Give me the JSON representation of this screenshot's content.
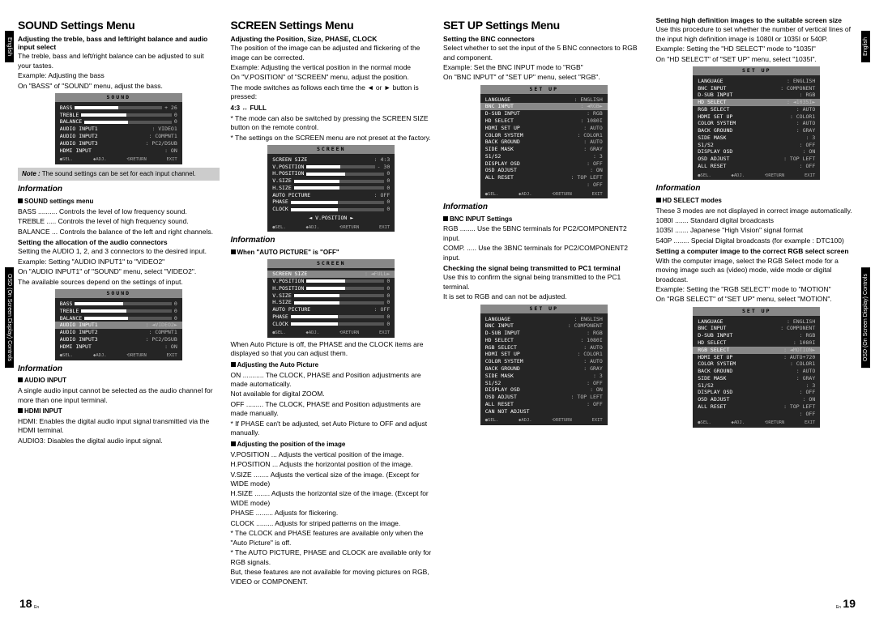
{
  "tabs": {
    "english": "English",
    "osd": "OSD (On Screen Display) Controls"
  },
  "col1": {
    "h2": "SOUND Settings Menu",
    "h3a": "Adjusting the treble, bass and left/right balance and audio input select",
    "p1": "The treble, bass and left/right balance can be adjusted to suit your tastes.",
    "ex1": "Example: Adjusting the bass",
    "p2": "On \"BASS\" of \"SOUND\" menu, adjust the bass.",
    "note": "The sound settings can be set for each input channel.",
    "info": "Information",
    "h4a": "SOUND settings menu",
    "def1": "BASS .......... Controls the level of low frequency sound.",
    "def2": "TREBLE ..... Controls the level of high frequency sound.",
    "def3": "BALANCE ... Controls the balance of the left and right channels.",
    "h3b": "Setting the allocation of the audio connectors",
    "p3": "Setting the AUDIO 1, 2, and 3 connectors to the desired input.",
    "ex2": "Example: Setting \"AUDIO INPUT1\" to \"VIDEO2\"",
    "p4": "On \"AUDIO INPUT1\" of \"SOUND\" menu, select \"VIDEO2\".",
    "p5": "The available sources depend on the settings of input.",
    "h4b": "AUDIO INPUT",
    "p6": "A single audio input cannot be selected as the audio channel for more than one input terminal.",
    "h4c": "HDMI INPUT",
    "def4": "HDMI: Enables the digital audio input signal transmitted via the HDMI terminal.",
    "def5": "AUDIO3: Disables the digital audio input signal."
  },
  "osd1": {
    "title": "SOUND",
    "rows": [
      [
        "BASS",
        "■",
        "+ 26"
      ],
      [
        "TREBLE",
        "■",
        "0"
      ],
      [
        "BALANCE",
        "■",
        "0"
      ],
      [
        "AUDIO INPUT1",
        ": VIDEO1"
      ],
      [
        "AUDIO INPUT2",
        ": COMPNT1"
      ],
      [
        "AUDIO INPUT3",
        ": PC2/DSUB"
      ],
      [
        "HDMI INPUT",
        ": ON"
      ]
    ]
  },
  "osd2": {
    "title": "SOUND",
    "rows": [
      [
        "BASS",
        "■",
        "0"
      ],
      [
        "TREBLE",
        "■",
        "0"
      ],
      [
        "BALANCE",
        "■",
        "0"
      ],
      [
        "AUDIO INPUT1",
        ": ◄VIDEO2►"
      ],
      [
        "AUDIO INPUT2",
        ": COMPNT1"
      ],
      [
        "AUDIO INPUT3",
        ": PC2/DSUB"
      ],
      [
        "HDMI INPUT",
        ": ON"
      ]
    ]
  },
  "col2": {
    "h2": "SCREEN Settings Menu",
    "h3a": "Adjusting the Position, Size, PHASE, CLOCK",
    "p1": "The position of the image can be adjusted and flickering of the image can be corrected.",
    "ex1": "Example: Adjusting the vertical position in the normal mode",
    "p2": "On \"V.POSITION\" of \"SCREEN\" menu, adjust the position.",
    "p3": "The mode switches as follows each time the ◄ or ► button is pressed:",
    "mode": "4:3 ↔ FULL",
    "b1": "* The mode can also be switched by pressing the SCREEN SIZE button on the remote control.",
    "b2": "* The settings on the SCREEN menu are not preset at the factory.",
    "info": "Information",
    "h4a": "When \"AUTO PICTURE\" is \"OFF\"",
    "p4": "When Auto Picture is off, the PHASE and the CLOCK items are displayed so that you can adjust them.",
    "h4b": "Adjusting the Auto Picture",
    "def1": "ON ........... The CLOCK, PHASE and Position adjustments are made automatically.",
    "def1b": "Not available for digital ZOOM.",
    "def2": "OFF ......... The CLOCK, PHASE and Position adjustments are made manually.",
    "b3": "* If PHASE can't be adjusted, set Auto Picture to OFF and adjust manually.",
    "h4c": "Adjusting the position of the image",
    "d1": "V.POSITION ... Adjusts the vertical position of the image.",
    "d2": "H.POSITION ... Adjusts the horizontal position of the image.",
    "d3": "V.SIZE ........ Adjusts the vertical size of the image. (Except for WIDE mode)",
    "d4": "H.SIZE ........ Adjusts the horizontal size of the image. (Except for WIDE mode)",
    "d5": "PHASE ......... Adjusts for flickering.",
    "d6": "CLOCK ......... Adjusts for striped patterns on the image.",
    "b4": "* The CLOCK and PHASE features are available only when the \"Auto Picture\" is off.",
    "b5": "* The AUTO PICTURE, PHASE and CLOCK are available only for RGB signals.",
    "b6": "But, these features are not available for moving pictures on RGB, VIDEO or COMPONENT."
  },
  "osd3": {
    "title": "SCREEN",
    "rows": [
      [
        "SCREEN SIZE",
        ": 4:3"
      ],
      [
        "V.POSITION",
        "■",
        "- 30"
      ],
      [
        "H.POSITION",
        "■",
        "0"
      ],
      [
        "V.SIZE",
        "■",
        "0"
      ],
      [
        "H.SIZE",
        "■",
        "0"
      ],
      [
        "AUTO PICTURE",
        ": OFF"
      ],
      [
        "PHASE",
        "■",
        "0"
      ],
      [
        "CLOCK",
        "■",
        "0"
      ]
    ],
    "mid": "◄  V.POSITION  ►"
  },
  "osd4": {
    "title": "SCREEN",
    "rows": [
      [
        "SCREEN SIZE",
        ": ◄FULL►"
      ],
      [
        "V.POSITION",
        "■",
        "0"
      ],
      [
        "H.POSITION",
        "■",
        "0"
      ],
      [
        "V.SIZE",
        "■",
        "0"
      ],
      [
        "H.SIZE",
        "■",
        "0"
      ],
      [
        "AUTO PICTURE",
        ": OFF"
      ],
      [
        "PHASE",
        "■",
        "0"
      ],
      [
        "CLOCK",
        "■",
        "0"
      ]
    ]
  },
  "col3": {
    "h2": "SET UP Settings Menu",
    "h3a": "Setting the BNC connectors",
    "p1": "Select whether to set the input of the 5 BNC connectors to RGB and component.",
    "ex1": "Example: Set the BNC INPUT mode to \"RGB\"",
    "p2": "On \"BNC INPUT\" of \"SET UP\" menu, select \"RGB\".",
    "info": "Information",
    "h4a": "BNC INPUT Settings",
    "d1": "RGB ........ Use the 5BNC terminals for PC2/COMPONENT2 input.",
    "d2": "COMP. ..... Use the 3BNC terminals for PC2/COMPONENT2 input.",
    "h3b": "Checking the signal being transmitted to PC1 terminal",
    "p3": "Use this to confirm the signal being transmitted to the PC1 terminal.",
    "p4": "It is set to RGB and can not be adjusted."
  },
  "osd5": {
    "title": "SET UP",
    "rows": [
      [
        "LANGUAGE",
        ": ENGLISH"
      ],
      [
        "BNC INPUT",
        ": ◄RGB►"
      ],
      [
        "D-SUB INPUT",
        ": RGB"
      ],
      [
        "HD SELECT",
        ": 1080I"
      ],
      [
        "HDMI SET UP",
        ": AUTO"
      ],
      [
        "COLOR SYSTEM",
        ": COLOR1"
      ],
      [
        "BACK GROUND",
        ": AUTO"
      ],
      [
        "SIDE MASK",
        ": GRAY"
      ],
      [
        "S1/S2",
        ": 3"
      ],
      [
        "DISPLAY OSD",
        ": OFF"
      ],
      [
        "OSD ADJUST",
        ": ON"
      ],
      [
        "ALL RESET",
        ": TOP LEFT"
      ],
      [
        "",
        ": OFF"
      ]
    ]
  },
  "osd6": {
    "title": "SET UP",
    "rows": [
      [
        "LANGUAGE",
        ": ENGLISH"
      ],
      [
        "BNC INPUT",
        ": COMPONENT"
      ],
      [
        "D-SUB INPUT",
        ": RGB"
      ],
      [
        "HD SELECT",
        ": 1080I"
      ],
      [
        "RGB SELECT",
        ": AUTO"
      ],
      [
        "HDMI SET UP",
        ": COLOR1"
      ],
      [
        "COLOR SYSTEM",
        ": AUTO"
      ],
      [
        "BACK GROUND",
        ": GRAY"
      ],
      [
        "SIDE MASK",
        ": 3"
      ],
      [
        "S1/S2",
        ": OFF"
      ],
      [
        "DISPLAY OSD",
        ": ON"
      ],
      [
        "OSD ADJUST",
        ": TOP LEFT"
      ],
      [
        "ALL RESET",
        ": OFF"
      ],
      [
        "CAN NOT ADJUST",
        ""
      ]
    ]
  },
  "col4": {
    "h3a": "Setting high definition images to the suitable screen size",
    "p1": "Use this procedure to set whether the number of vertical lines of the input high definition image is 1080I or 1035I or 540P.",
    "ex1": "Example: Setting the \"HD SELECT\" mode to \"1035I\"",
    "p2": "On \"HD SELECT\" of \"SET UP\" menu, select \"1035I\".",
    "info": "Information",
    "h4a": "HD SELECT modes",
    "p3": "These 3 modes are not displayed in correct image automatically.",
    "d1": "1080I ....... Standard digital broadcasts",
    "d2": "1035I ....... Japanese \"High Vision\" signal format",
    "d3": "540P ........ Special Digital broadcasts (for example : DTC100)",
    "h3b": "Setting a computer image to the correct RGB select screen",
    "p4": "With the computer image, select the RGB Select mode for a moving image such as (video) mode, wide mode or digital broadcast.",
    "ex2": "Example: Setting the \"RGB SELECT\" mode to \"MOTION\"",
    "p5": "On \"RGB SELECT\" of \"SET UP\" menu, select \"MOTION\"."
  },
  "osd7": {
    "title": "SET UP",
    "rows": [
      [
        "LANGUAGE",
        ": ENGLISH"
      ],
      [
        "BNC INPUT",
        ": COMPONENT"
      ],
      [
        "D-SUB INPUT",
        ": RGB"
      ],
      [
        "HD SELECT",
        ": ◄1035I►"
      ],
      [
        "RGB SELECT",
        ": AUTO"
      ],
      [
        "HDMI SET UP",
        ": COLOR1"
      ],
      [
        "COLOR SYSTEM",
        ": AUTO"
      ],
      [
        "BACK GROUND",
        ": GRAY"
      ],
      [
        "SIDE MASK",
        ": 3"
      ],
      [
        "S1/S2",
        ": OFF"
      ],
      [
        "DISPLAY OSD",
        ": ON"
      ],
      [
        "OSD ADJUST",
        ": TOP LEFT"
      ],
      [
        "ALL RESET",
        ": OFF"
      ]
    ]
  },
  "osd8": {
    "title": "SET UP",
    "rows": [
      [
        "LANGUAGE",
        ": ENGLISH"
      ],
      [
        "BNC INPUT",
        ": COMPONENT"
      ],
      [
        "D-SUB INPUT",
        ": RGB"
      ],
      [
        "HD SELECT",
        ": 1080I"
      ],
      [
        "RGB SELECT",
        ": ◄MOTION►"
      ],
      [
        "HDMI SET UP",
        ": AUTO+720"
      ],
      [
        "COLOR SYSTEM",
        ": COLOR1"
      ],
      [
        "BACK GROUND",
        ": AUTO"
      ],
      [
        "SIDE MASK",
        ": GRAY"
      ],
      [
        "S1/S2",
        ": 3"
      ],
      [
        "DISPLAY OSD",
        ": OFF"
      ],
      [
        "OSD ADJUST",
        ": ON"
      ],
      [
        "ALL RESET",
        ": TOP LEFT"
      ],
      [
        "",
        ": OFF"
      ]
    ]
  },
  "foot": {
    "sel": "●SEL.",
    "adj": "◆ADJ.",
    "ret": "⟲RETURN",
    "ex": "EXIT",
    "p18": "18",
    "p19": "19",
    "en": "En"
  }
}
